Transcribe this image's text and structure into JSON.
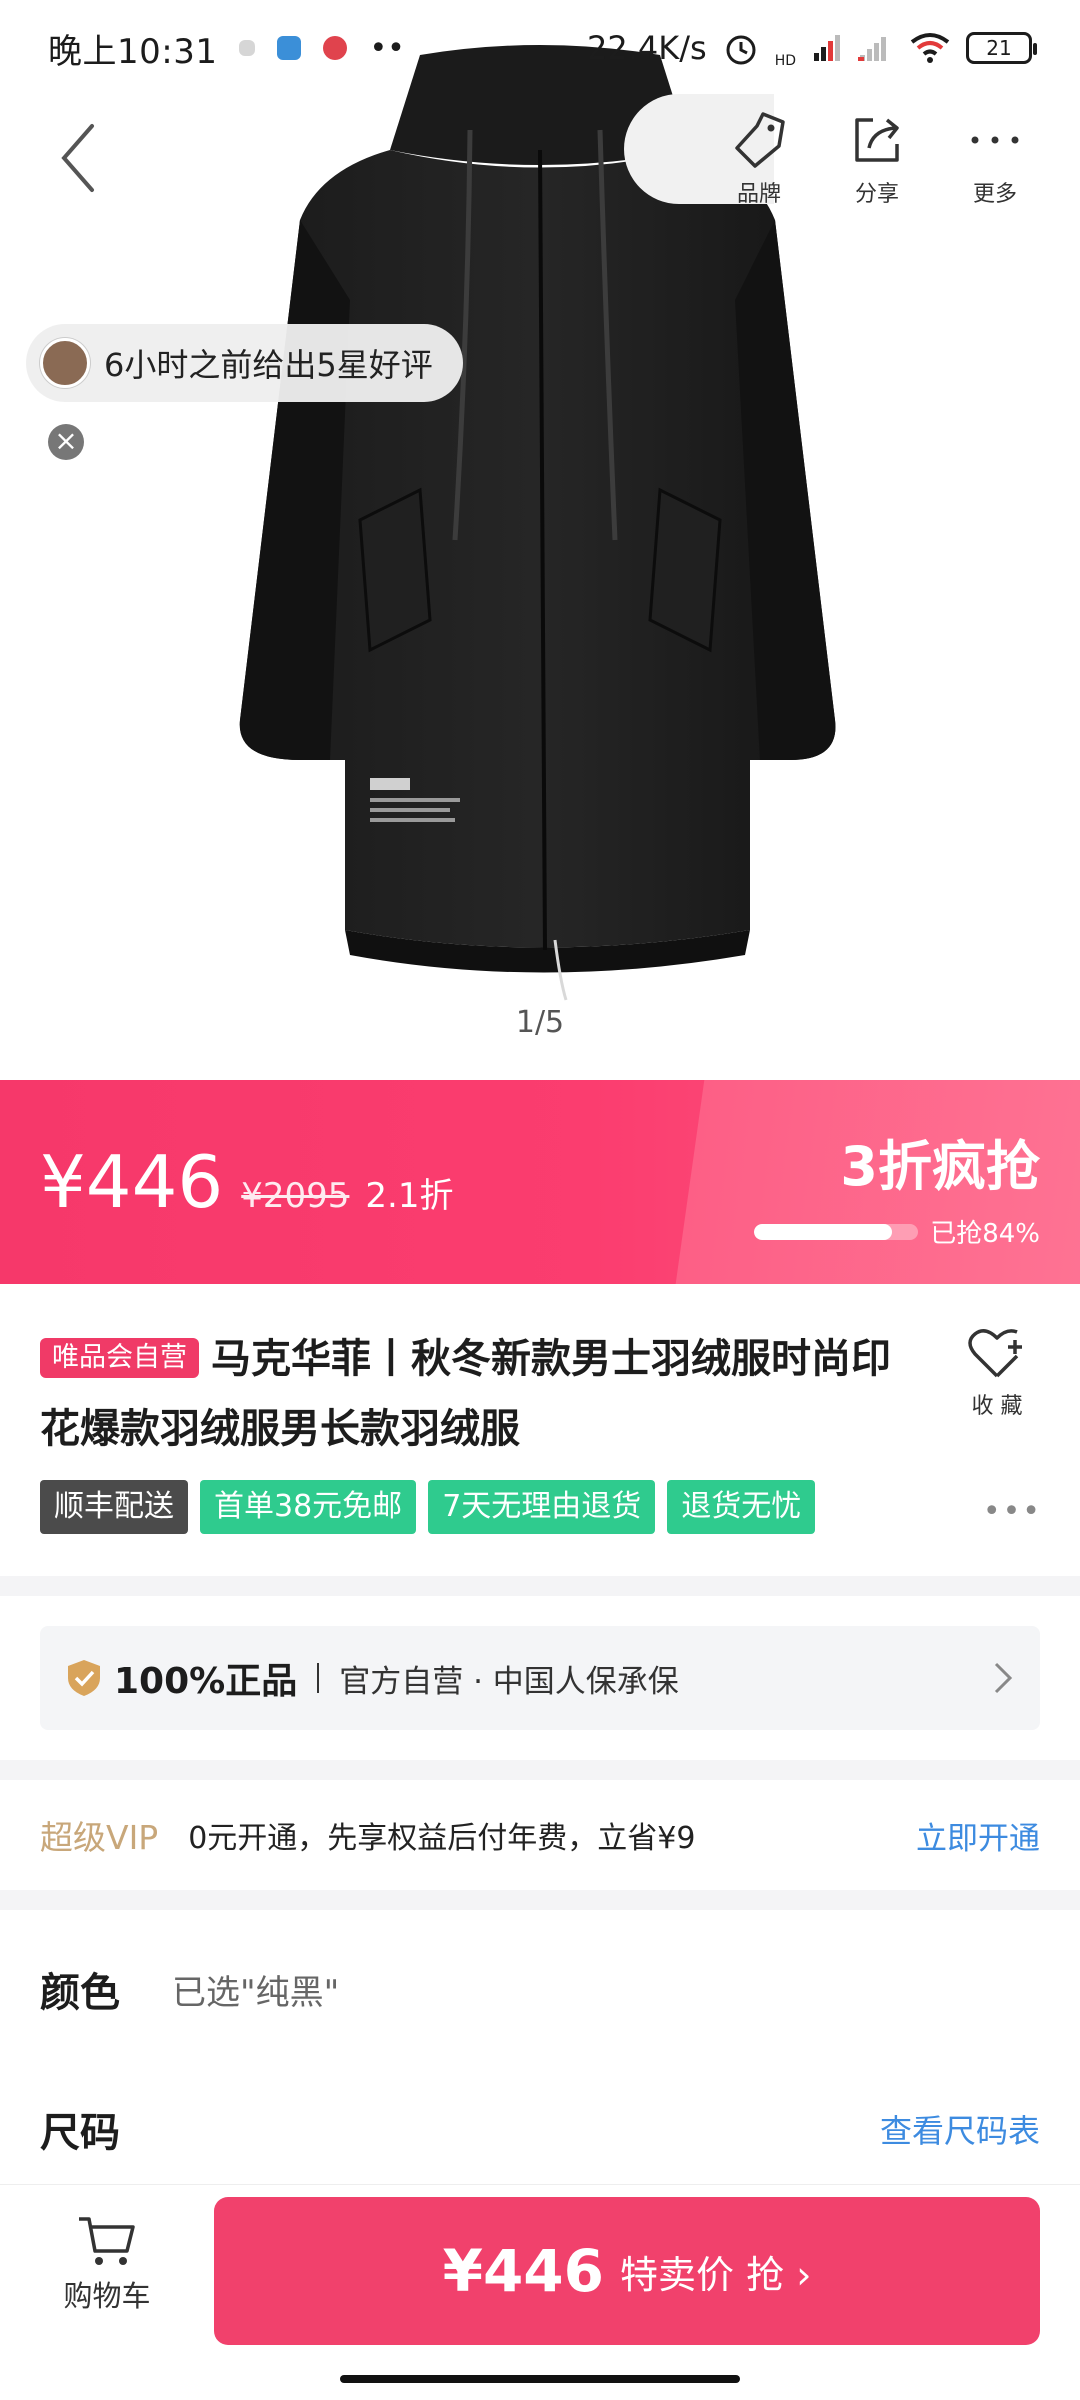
{
  "status_bar": {
    "time": "晚上10:31",
    "net_speed": "22.4K/s",
    "hd_label": "HD",
    "battery": "21"
  },
  "nav": {
    "brand_label": "品牌",
    "share_label": "分享",
    "more_label": "更多"
  },
  "review_toast": {
    "text": "6小时之前给出5星好评",
    "close_glyph": "×"
  },
  "image_counter": "1/5",
  "price": {
    "current": "¥446",
    "original": "¥2095",
    "discount": "2.1折",
    "flash_title": "3折疯抢",
    "sold_text": "已抢84%",
    "sold_fraction": 0.84
  },
  "product": {
    "self_operated_tag": "唯品会自营",
    "title": "马克华菲丨秋冬新款男士羽绒服时尚印花爆款羽绒服男长款羽绒服",
    "favorite_label": "收 藏",
    "tags": [
      {
        "text": "顺丰配送",
        "style": "dark"
      },
      {
        "text": "首单38元免邮",
        "style": "green"
      },
      {
        "text": "7天无理由退货",
        "style": "green"
      },
      {
        "text": "退货无忧",
        "style": "green"
      }
    ],
    "more_glyph": "•••"
  },
  "authentic": {
    "title": "100%正品",
    "text": "官方自营 · 中国人保承保"
  },
  "vip": {
    "label": "超级VIP",
    "text": "0元开通，先享权益后付年费，立省¥9",
    "link": "立即开通"
  },
  "options": {
    "color_label": "颜色",
    "color_value": "已选\"纯黑\"",
    "size_label": "尺码",
    "size_link": "查看尺码表"
  },
  "bottom_bar": {
    "cart_label": "购物车",
    "buy_price": "¥446",
    "buy_label": "特卖价 抢 ›"
  },
  "colors": {
    "accent": "#f1416c",
    "tag_green": "#2fcb8e",
    "link_blue": "#3d8be0",
    "vip_gold": "#c8a77a"
  }
}
